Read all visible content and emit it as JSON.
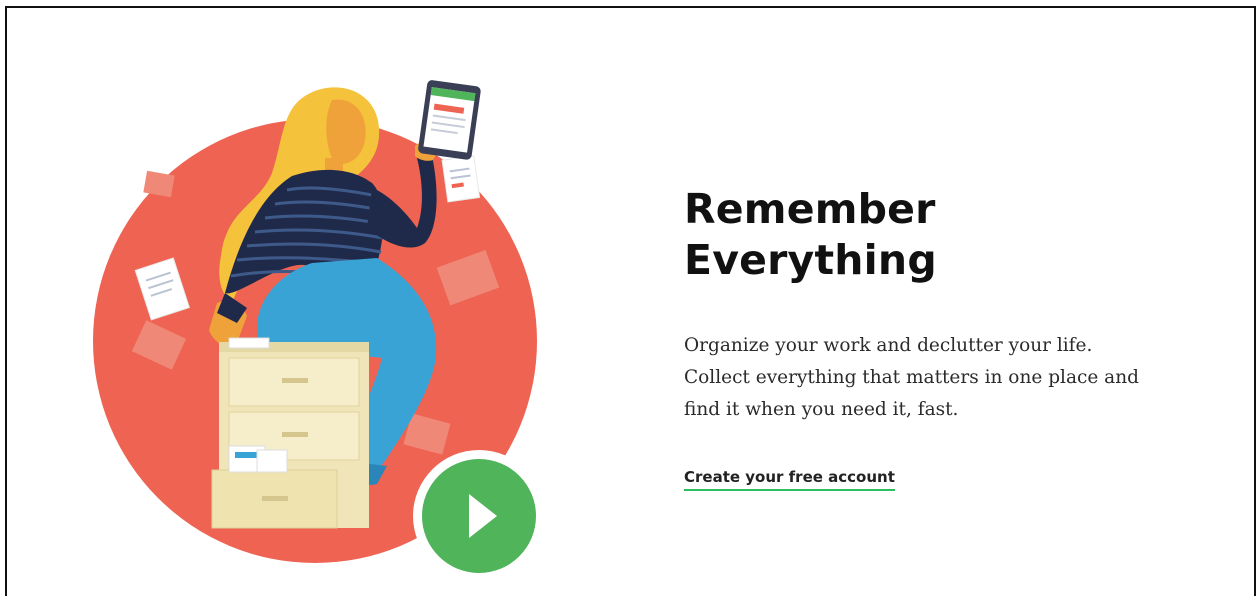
{
  "hero": {
    "headline_line1": "Remember",
    "headline_line2": "Everything",
    "description_line1": "Organize your work and declutter your life.",
    "description_line2": "Collect everything that matters in one place and",
    "description_line3": "find it when you need it, fast.",
    "cta_label": "Create your free account",
    "cta_underline_color": "#2dbe60"
  },
  "illustration": {
    "circle_color": "#ee6352",
    "play_button_color": "#4fb45a",
    "hair_color": "#f5c33b",
    "shirt_color": "#1f2a4a",
    "pants_color": "#3aa3d6",
    "cabinet_color": "#f0e5b8"
  }
}
